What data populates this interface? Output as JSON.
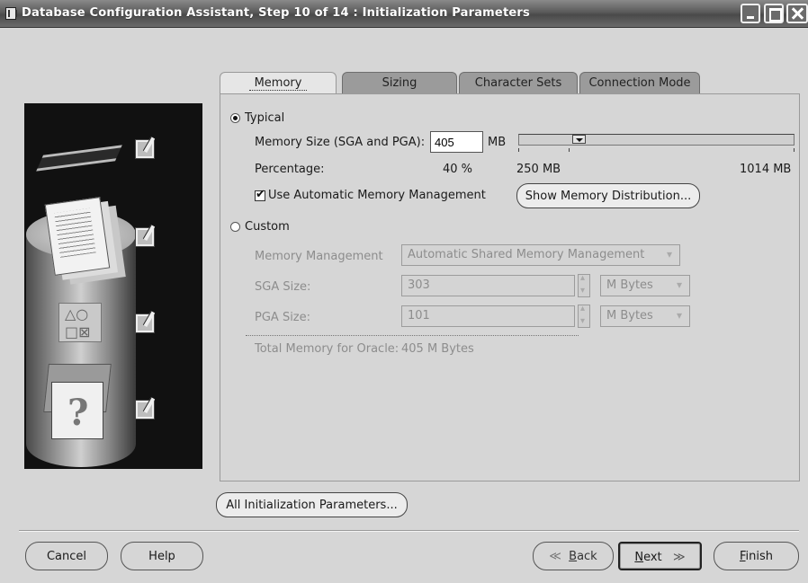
{
  "window": {
    "title": "Database Configuration Assistant, Step 10 of 14 : Initialization Parameters"
  },
  "tabs": [
    {
      "label": "Memory",
      "active": true
    },
    {
      "label": "Sizing",
      "active": false
    },
    {
      "label": "Character Sets",
      "active": false
    },
    {
      "label": "Connection Mode",
      "active": false
    }
  ],
  "memory": {
    "typical": {
      "label": "Typical",
      "selected": true,
      "memory_size_label": "Memory Size (SGA and PGA):",
      "memory_size_value": "405",
      "memory_size_unit": "MB",
      "percentage_label": "Percentage:",
      "percentage_value": "40 %",
      "slider_min_label": "250 MB",
      "slider_max_label": "1014 MB",
      "slider_value_mb": 405,
      "auto_memory_label": "Use Automatic Memory Management",
      "auto_memory_checked": true,
      "show_distribution_label": "Show Memory Distribution..."
    },
    "custom": {
      "label": "Custom",
      "selected": false,
      "memory_management_label": "Memory Management",
      "memory_management_value": "Automatic Shared Memory Management",
      "sga_label": "SGA Size:",
      "sga_value": "303",
      "sga_unit": "M Bytes",
      "pga_label": "PGA Size:",
      "pga_value": "101",
      "pga_unit": "M Bytes",
      "total_label": "Total Memory for Oracle:",
      "total_value": "405 M Bytes"
    }
  },
  "buttons": {
    "all_params": "All Initialization Parameters...",
    "cancel": "Cancel",
    "help": "Help",
    "back_arrow": "≪",
    "back_mnemonic": "B",
    "back_rest": "ack",
    "next_mnemonic": "N",
    "next_rest": "ext",
    "next_arrow": "≫",
    "finish_mnemonic": "F",
    "finish_rest": "inish"
  },
  "colors": {
    "window_bg": "#d6d6d6",
    "titlebar": "#5a5a5a",
    "inactive_tab": "#9b9b9b",
    "active_tab": "#e6e6e6"
  }
}
